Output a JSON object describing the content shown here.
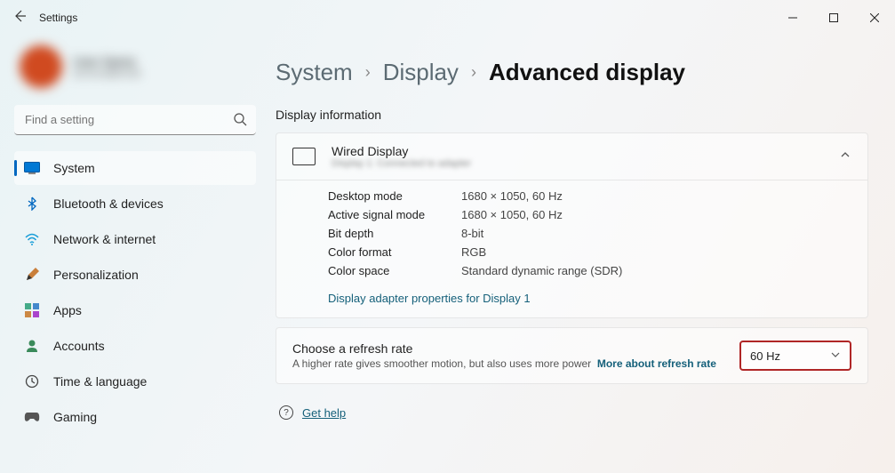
{
  "titlebar": {
    "title": "Settings"
  },
  "profile": {
    "name": "User Name",
    "sub": "account@email"
  },
  "search": {
    "placeholder": "Find a setting"
  },
  "nav": [
    {
      "label": "System",
      "icon": "system"
    },
    {
      "label": "Bluetooth & devices",
      "icon": "bluetooth"
    },
    {
      "label": "Network & internet",
      "icon": "network"
    },
    {
      "label": "Personalization",
      "icon": "personalization"
    },
    {
      "label": "Apps",
      "icon": "apps"
    },
    {
      "label": "Accounts",
      "icon": "accounts"
    },
    {
      "label": "Time & language",
      "icon": "time"
    },
    {
      "label": "Gaming",
      "icon": "gaming"
    }
  ],
  "breadcrumb": {
    "a": "System",
    "b": "Display",
    "c": "Advanced display"
  },
  "section_title": "Display information",
  "display_card": {
    "title": "Wired Display",
    "sub": "Display 1: Connected to adapter",
    "rows": {
      "desktop_mode_k": "Desktop mode",
      "desktop_mode_v": "1680 × 1050, 60 Hz",
      "active_signal_k": "Active signal mode",
      "active_signal_v": "1680 × 1050, 60 Hz",
      "bit_depth_k": "Bit depth",
      "bit_depth_v": "8-bit",
      "color_format_k": "Color format",
      "color_format_v": "RGB",
      "color_space_k": "Color space",
      "color_space_v": "Standard dynamic range (SDR)"
    },
    "adapter_link": "Display adapter properties for Display 1"
  },
  "refresh": {
    "title": "Choose a refresh rate",
    "sub": "A higher rate gives smoother motion, but also uses more power",
    "link": "More about refresh rate",
    "value": "60 Hz"
  },
  "help": "Get help"
}
